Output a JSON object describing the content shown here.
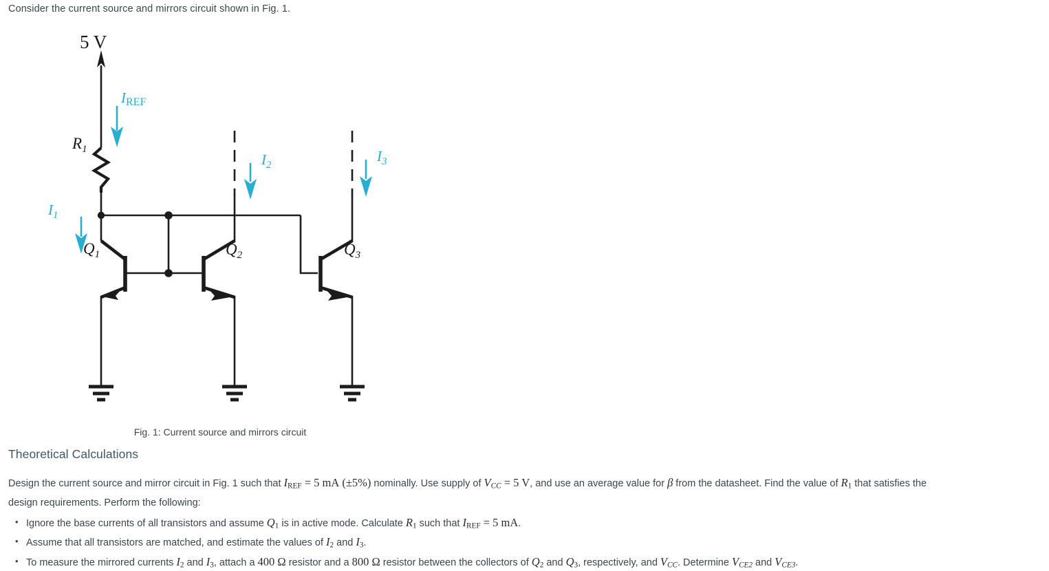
{
  "intro": {
    "text": "Consider the current source and mirrors circuit shown in Fig. 1."
  },
  "figure": {
    "caption": "Fig. 1: Current source and mirrors circuit",
    "labels": {
      "supply": "5 V",
      "i_ref": "I",
      "i_ref_sub": "REF",
      "r1": "R",
      "r1_sub": "1",
      "i1": "I",
      "i1_sub": "1",
      "i2": "I",
      "i2_sub": "2",
      "i3": "I",
      "i3_sub": "3",
      "q1": "Q",
      "q1_sub": "1",
      "q2": "Q",
      "q2_sub": "2",
      "q3": "Q",
      "q3_sub": "3"
    },
    "colors": {
      "wire": "#1c1c1c",
      "current_arrow": "#27afd2",
      "label": "#1a1a1a"
    }
  },
  "section": {
    "heading": "Theoretical Calculations"
  },
  "paragraph": {
    "p1": "Design the current source and mirror circuit in Fig. 1 such that ",
    "iref": "I",
    "iref_sub": "REF",
    "eq1": " = ",
    "val1": "5 mA",
    "tol": "(±5%)",
    "p2": " nominally. Use supply of ",
    "vcc": "V",
    "vcc_sub": "CC",
    "eq2": " = ",
    "val2": "5 V",
    "p3": ", and use an average value for ",
    "beta": "β",
    "p4": " from the datasheet. Find the value of ",
    "r1": "R",
    "r1_sub": "1",
    "p5": " that satisfies the",
    "p6": "design requirements. Perform the following:"
  },
  "bullets": [
    {
      "id": "bullet-ignore-base-currents",
      "parts": [
        {
          "t": "txt",
          "v": "Ignore the base currents of all transistors and assume "
        },
        {
          "t": "var",
          "v": "Q",
          "sub": "1"
        },
        {
          "t": "txt",
          "v": " is in active mode. Calculate "
        },
        {
          "t": "var",
          "v": "R",
          "sub": "1"
        },
        {
          "t": "txt",
          "v": " such that "
        },
        {
          "t": "var",
          "v": "I",
          "sub": "REF"
        },
        {
          "t": "num",
          "v": " = 5 mA"
        },
        {
          "t": "txt",
          "v": "."
        }
      ]
    },
    {
      "id": "bullet-matched-transistors",
      "parts": [
        {
          "t": "txt",
          "v": " Assume that all transistors are matched, and estimate the values of "
        },
        {
          "t": "var",
          "v": "I",
          "sub": "2"
        },
        {
          "t": "txt",
          "v": " and "
        },
        {
          "t": "var",
          "v": "I",
          "sub": "3"
        },
        {
          "t": "txt",
          "v": "."
        }
      ]
    },
    {
      "id": "bullet-measure-mirrored-currents",
      "parts": [
        {
          "t": "txt",
          "v": "To measure the mirrored currents "
        },
        {
          "t": "var",
          "v": "I",
          "sub": "2"
        },
        {
          "t": "txt",
          "v": " and "
        },
        {
          "t": "var",
          "v": "I",
          "sub": "3"
        },
        {
          "t": "txt",
          "v": ", attach a "
        },
        {
          "t": "num",
          "v": "400 Ω"
        },
        {
          "t": "txt",
          "v": " resistor and a "
        },
        {
          "t": "num",
          "v": "800 Ω"
        },
        {
          "t": "txt",
          "v": " resistor between the collectors of "
        },
        {
          "t": "var",
          "v": "Q",
          "sub": "2"
        },
        {
          "t": "txt",
          "v": " and "
        },
        {
          "t": "var",
          "v": "Q",
          "sub": "3"
        },
        {
          "t": "txt",
          "v": ", respectively, and "
        },
        {
          "t": "var",
          "v": "V",
          "sub": "CC",
          "subit": true
        },
        {
          "t": "txt",
          "v": ". Determine "
        },
        {
          "t": "var",
          "v": "V",
          "sub": "CE2",
          "subit": true
        },
        {
          "t": "txt",
          "v": " and "
        },
        {
          "t": "var",
          "v": "V",
          "sub": "CE3",
          "subit": true
        },
        {
          "t": "txt",
          "v": "."
        }
      ]
    }
  ]
}
